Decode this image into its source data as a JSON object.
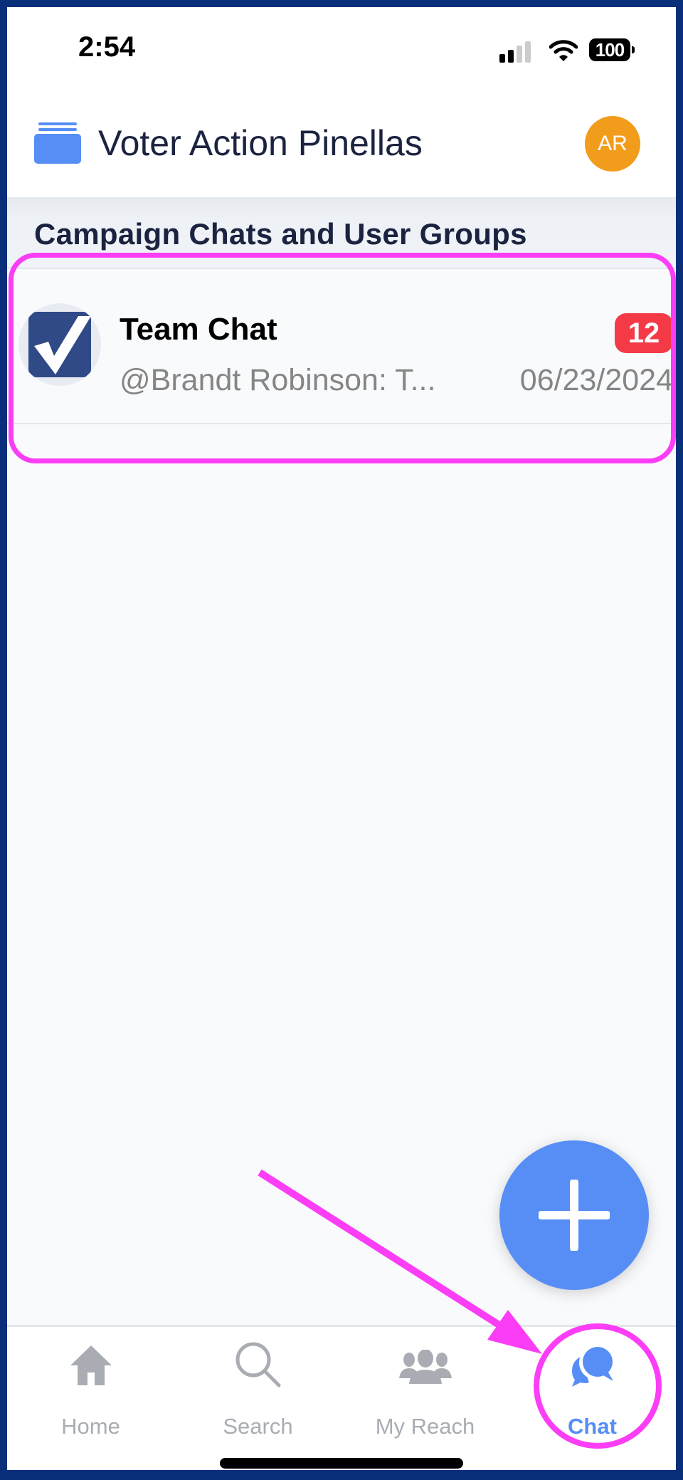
{
  "status_bar": {
    "time": "2:54",
    "battery": "100",
    "signal_bars_active": 2,
    "signal_bars_total": 4,
    "icons": [
      "cellular-signal-icon",
      "wifi-icon",
      "battery-icon"
    ]
  },
  "header": {
    "app_icon": "folder-stack-icon",
    "title": "Voter Action Pinellas",
    "avatar_initials": "AR",
    "avatar_color": "#f29c1b"
  },
  "section": {
    "title": "Campaign Chats and User Groups"
  },
  "chats": [
    {
      "name": "Team Chat",
      "logo_icon": "checkmark-logo-icon",
      "preview": "@Brandt Robinson: T...",
      "date": "06/23/2024",
      "unread_count": "12"
    }
  ],
  "fab": {
    "icon": "plus-icon",
    "color": "#578ef6"
  },
  "tab_bar": {
    "active": "Chat",
    "tabs": [
      {
        "label": "Home",
        "icon": "home-icon"
      },
      {
        "label": "Search",
        "icon": "search-icon"
      },
      {
        "label": "My Reach",
        "icon": "people-group-icon"
      },
      {
        "label": "Chat",
        "icon": "chat-bubbles-icon"
      }
    ]
  },
  "colors": {
    "accent": "#578ef6",
    "badge": "#f53a47",
    "annotation": "#fb3ef6",
    "frame": "#0a2f7a",
    "inactive_tab": "#a9adb3"
  },
  "annotations": {
    "highlight_box_target": "Team Chat",
    "arrow_target": "Chat"
  }
}
